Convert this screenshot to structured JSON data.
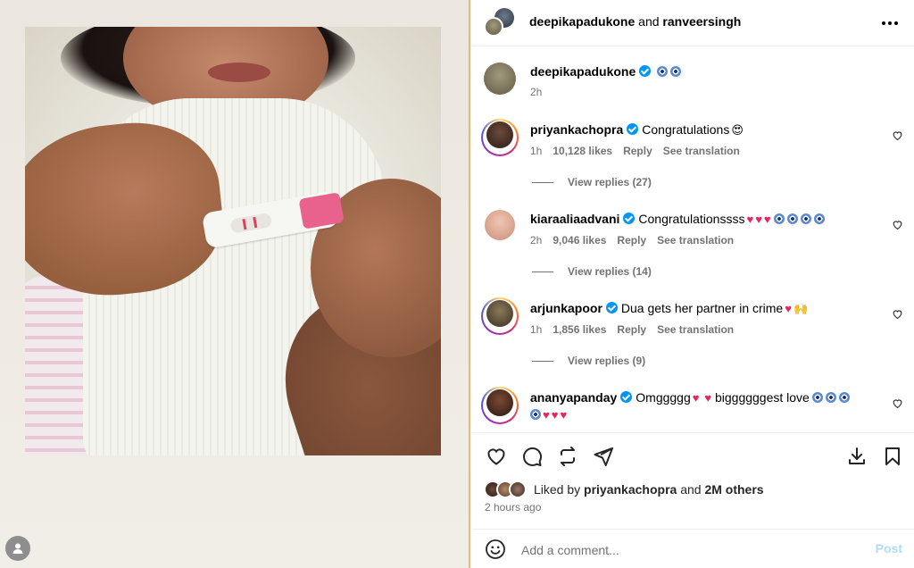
{
  "header": {
    "user1": "deepikapadukone",
    "and": "and",
    "user2": "ranveersingh"
  },
  "caption": {
    "username": "deepikapadukone",
    "time": "2h"
  },
  "comments": [
    {
      "username": "priyankachopra",
      "text": "Congratulations",
      "emoji": "😍",
      "time": "1h",
      "likes": "10,128 likes",
      "reply": "Reply",
      "translate": "See translation",
      "view_replies": "View replies (27)"
    },
    {
      "username": "kiaraaliaadvani",
      "text": "Congratulationssss",
      "time": "2h",
      "likes": "9,046 likes",
      "reply": "Reply",
      "translate": "See translation",
      "view_replies": "View replies (14)"
    },
    {
      "username": "arjunkapoor",
      "text": "Dua gets her partner in crime",
      "emoji": "🙌",
      "time": "1h",
      "likes": "1,856 likes",
      "reply": "Reply",
      "translate": "See translation",
      "view_replies": "View replies (9)"
    },
    {
      "username": "ananyapanday",
      "text": "Omggggg",
      "text2": "biggggggest love"
    }
  ],
  "likes": {
    "prefix": "Liked by",
    "user": "priyankachopra",
    "and": "and",
    "others": "2M others"
  },
  "timestamp": "2 hours ago",
  "comment_box": {
    "placeholder": "Add a comment...",
    "post_label": "Post"
  },
  "colors": {
    "verified": "#0095f6",
    "heart_red": "#e8245c",
    "post_button_disabled": "#b3dbff",
    "muted_text": "#737373"
  },
  "icons": [
    "more-icon",
    "heart-icon",
    "comment-icon",
    "share-icon",
    "send-icon",
    "download-icon",
    "bookmark-icon",
    "smiley-icon",
    "verified-icon",
    "evil-eye-icon",
    "user-icon"
  ]
}
